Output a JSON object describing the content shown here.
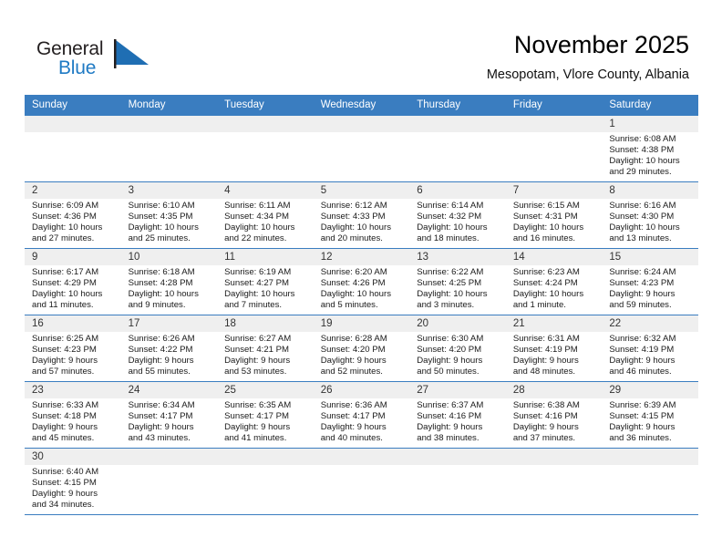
{
  "brand": {
    "name_part1": "General",
    "name_part2": "Blue",
    "logo_icon": "blue-flag-triangle-icon",
    "color_primary": "#1f7ac4",
    "color_dark": "#231f20"
  },
  "header": {
    "title": "November 2025",
    "subtitle": "Mesopotam, Vlore County, Albania"
  },
  "theme": {
    "header_row_bg": "#3a7dc0",
    "header_row_text": "#ffffff",
    "daynum_bg": "#efefef",
    "grid_line": "#3a7dc0"
  },
  "weekdays": [
    "Sunday",
    "Monday",
    "Tuesday",
    "Wednesday",
    "Thursday",
    "Friday",
    "Saturday"
  ],
  "labels": {
    "sunrise_prefix": "Sunrise:",
    "sunset_prefix": "Sunset:",
    "daylight_prefix": "Daylight:"
  },
  "weeks": [
    [
      {
        "empty": true
      },
      {
        "empty": true
      },
      {
        "empty": true
      },
      {
        "empty": true
      },
      {
        "empty": true
      },
      {
        "empty": true
      },
      {
        "day": "1",
        "sunrise": "Sunrise: 6:08 AM",
        "sunset": "Sunset: 4:38 PM",
        "daylight_1": "Daylight: 10 hours",
        "daylight_2": "and 29 minutes."
      }
    ],
    [
      {
        "day": "2",
        "sunrise": "Sunrise: 6:09 AM",
        "sunset": "Sunset: 4:36 PM",
        "daylight_1": "Daylight: 10 hours",
        "daylight_2": "and 27 minutes."
      },
      {
        "day": "3",
        "sunrise": "Sunrise: 6:10 AM",
        "sunset": "Sunset: 4:35 PM",
        "daylight_1": "Daylight: 10 hours",
        "daylight_2": "and 25 minutes."
      },
      {
        "day": "4",
        "sunrise": "Sunrise: 6:11 AM",
        "sunset": "Sunset: 4:34 PM",
        "daylight_1": "Daylight: 10 hours",
        "daylight_2": "and 22 minutes."
      },
      {
        "day": "5",
        "sunrise": "Sunrise: 6:12 AM",
        "sunset": "Sunset: 4:33 PM",
        "daylight_1": "Daylight: 10 hours",
        "daylight_2": "and 20 minutes."
      },
      {
        "day": "6",
        "sunrise": "Sunrise: 6:14 AM",
        "sunset": "Sunset: 4:32 PM",
        "daylight_1": "Daylight: 10 hours",
        "daylight_2": "and 18 minutes."
      },
      {
        "day": "7",
        "sunrise": "Sunrise: 6:15 AM",
        "sunset": "Sunset: 4:31 PM",
        "daylight_1": "Daylight: 10 hours",
        "daylight_2": "and 16 minutes."
      },
      {
        "day": "8",
        "sunrise": "Sunrise: 6:16 AM",
        "sunset": "Sunset: 4:30 PM",
        "daylight_1": "Daylight: 10 hours",
        "daylight_2": "and 13 minutes."
      }
    ],
    [
      {
        "day": "9",
        "sunrise": "Sunrise: 6:17 AM",
        "sunset": "Sunset: 4:29 PM",
        "daylight_1": "Daylight: 10 hours",
        "daylight_2": "and 11 minutes."
      },
      {
        "day": "10",
        "sunrise": "Sunrise: 6:18 AM",
        "sunset": "Sunset: 4:28 PM",
        "daylight_1": "Daylight: 10 hours",
        "daylight_2": "and 9 minutes."
      },
      {
        "day": "11",
        "sunrise": "Sunrise: 6:19 AM",
        "sunset": "Sunset: 4:27 PM",
        "daylight_1": "Daylight: 10 hours",
        "daylight_2": "and 7 minutes."
      },
      {
        "day": "12",
        "sunrise": "Sunrise: 6:20 AM",
        "sunset": "Sunset: 4:26 PM",
        "daylight_1": "Daylight: 10 hours",
        "daylight_2": "and 5 minutes."
      },
      {
        "day": "13",
        "sunrise": "Sunrise: 6:22 AM",
        "sunset": "Sunset: 4:25 PM",
        "daylight_1": "Daylight: 10 hours",
        "daylight_2": "and 3 minutes."
      },
      {
        "day": "14",
        "sunrise": "Sunrise: 6:23 AM",
        "sunset": "Sunset: 4:24 PM",
        "daylight_1": "Daylight: 10 hours",
        "daylight_2": "and 1 minute."
      },
      {
        "day": "15",
        "sunrise": "Sunrise: 6:24 AM",
        "sunset": "Sunset: 4:23 PM",
        "daylight_1": "Daylight: 9 hours",
        "daylight_2": "and 59 minutes."
      }
    ],
    [
      {
        "day": "16",
        "sunrise": "Sunrise: 6:25 AM",
        "sunset": "Sunset: 4:23 PM",
        "daylight_1": "Daylight: 9 hours",
        "daylight_2": "and 57 minutes."
      },
      {
        "day": "17",
        "sunrise": "Sunrise: 6:26 AM",
        "sunset": "Sunset: 4:22 PM",
        "daylight_1": "Daylight: 9 hours",
        "daylight_2": "and 55 minutes."
      },
      {
        "day": "18",
        "sunrise": "Sunrise: 6:27 AM",
        "sunset": "Sunset: 4:21 PM",
        "daylight_1": "Daylight: 9 hours",
        "daylight_2": "and 53 minutes."
      },
      {
        "day": "19",
        "sunrise": "Sunrise: 6:28 AM",
        "sunset": "Sunset: 4:20 PM",
        "daylight_1": "Daylight: 9 hours",
        "daylight_2": "and 52 minutes."
      },
      {
        "day": "20",
        "sunrise": "Sunrise: 6:30 AM",
        "sunset": "Sunset: 4:20 PM",
        "daylight_1": "Daylight: 9 hours",
        "daylight_2": "and 50 minutes."
      },
      {
        "day": "21",
        "sunrise": "Sunrise: 6:31 AM",
        "sunset": "Sunset: 4:19 PM",
        "daylight_1": "Daylight: 9 hours",
        "daylight_2": "and 48 minutes."
      },
      {
        "day": "22",
        "sunrise": "Sunrise: 6:32 AM",
        "sunset": "Sunset: 4:19 PM",
        "daylight_1": "Daylight: 9 hours",
        "daylight_2": "and 46 minutes."
      }
    ],
    [
      {
        "day": "23",
        "sunrise": "Sunrise: 6:33 AM",
        "sunset": "Sunset: 4:18 PM",
        "daylight_1": "Daylight: 9 hours",
        "daylight_2": "and 45 minutes."
      },
      {
        "day": "24",
        "sunrise": "Sunrise: 6:34 AM",
        "sunset": "Sunset: 4:17 PM",
        "daylight_1": "Daylight: 9 hours",
        "daylight_2": "and 43 minutes."
      },
      {
        "day": "25",
        "sunrise": "Sunrise: 6:35 AM",
        "sunset": "Sunset: 4:17 PM",
        "daylight_1": "Daylight: 9 hours",
        "daylight_2": "and 41 minutes."
      },
      {
        "day": "26",
        "sunrise": "Sunrise: 6:36 AM",
        "sunset": "Sunset: 4:17 PM",
        "daylight_1": "Daylight: 9 hours",
        "daylight_2": "and 40 minutes."
      },
      {
        "day": "27",
        "sunrise": "Sunrise: 6:37 AM",
        "sunset": "Sunset: 4:16 PM",
        "daylight_1": "Daylight: 9 hours",
        "daylight_2": "and 38 minutes."
      },
      {
        "day": "28",
        "sunrise": "Sunrise: 6:38 AM",
        "sunset": "Sunset: 4:16 PM",
        "daylight_1": "Daylight: 9 hours",
        "daylight_2": "and 37 minutes."
      },
      {
        "day": "29",
        "sunrise": "Sunrise: 6:39 AM",
        "sunset": "Sunset: 4:15 PM",
        "daylight_1": "Daylight: 9 hours",
        "daylight_2": "and 36 minutes."
      }
    ],
    [
      {
        "day": "30",
        "sunrise": "Sunrise: 6:40 AM",
        "sunset": "Sunset: 4:15 PM",
        "daylight_1": "Daylight: 9 hours",
        "daylight_2": "and 34 minutes."
      },
      {
        "empty": true
      },
      {
        "empty": true
      },
      {
        "empty": true
      },
      {
        "empty": true
      },
      {
        "empty": true
      },
      {
        "empty": true
      }
    ]
  ]
}
